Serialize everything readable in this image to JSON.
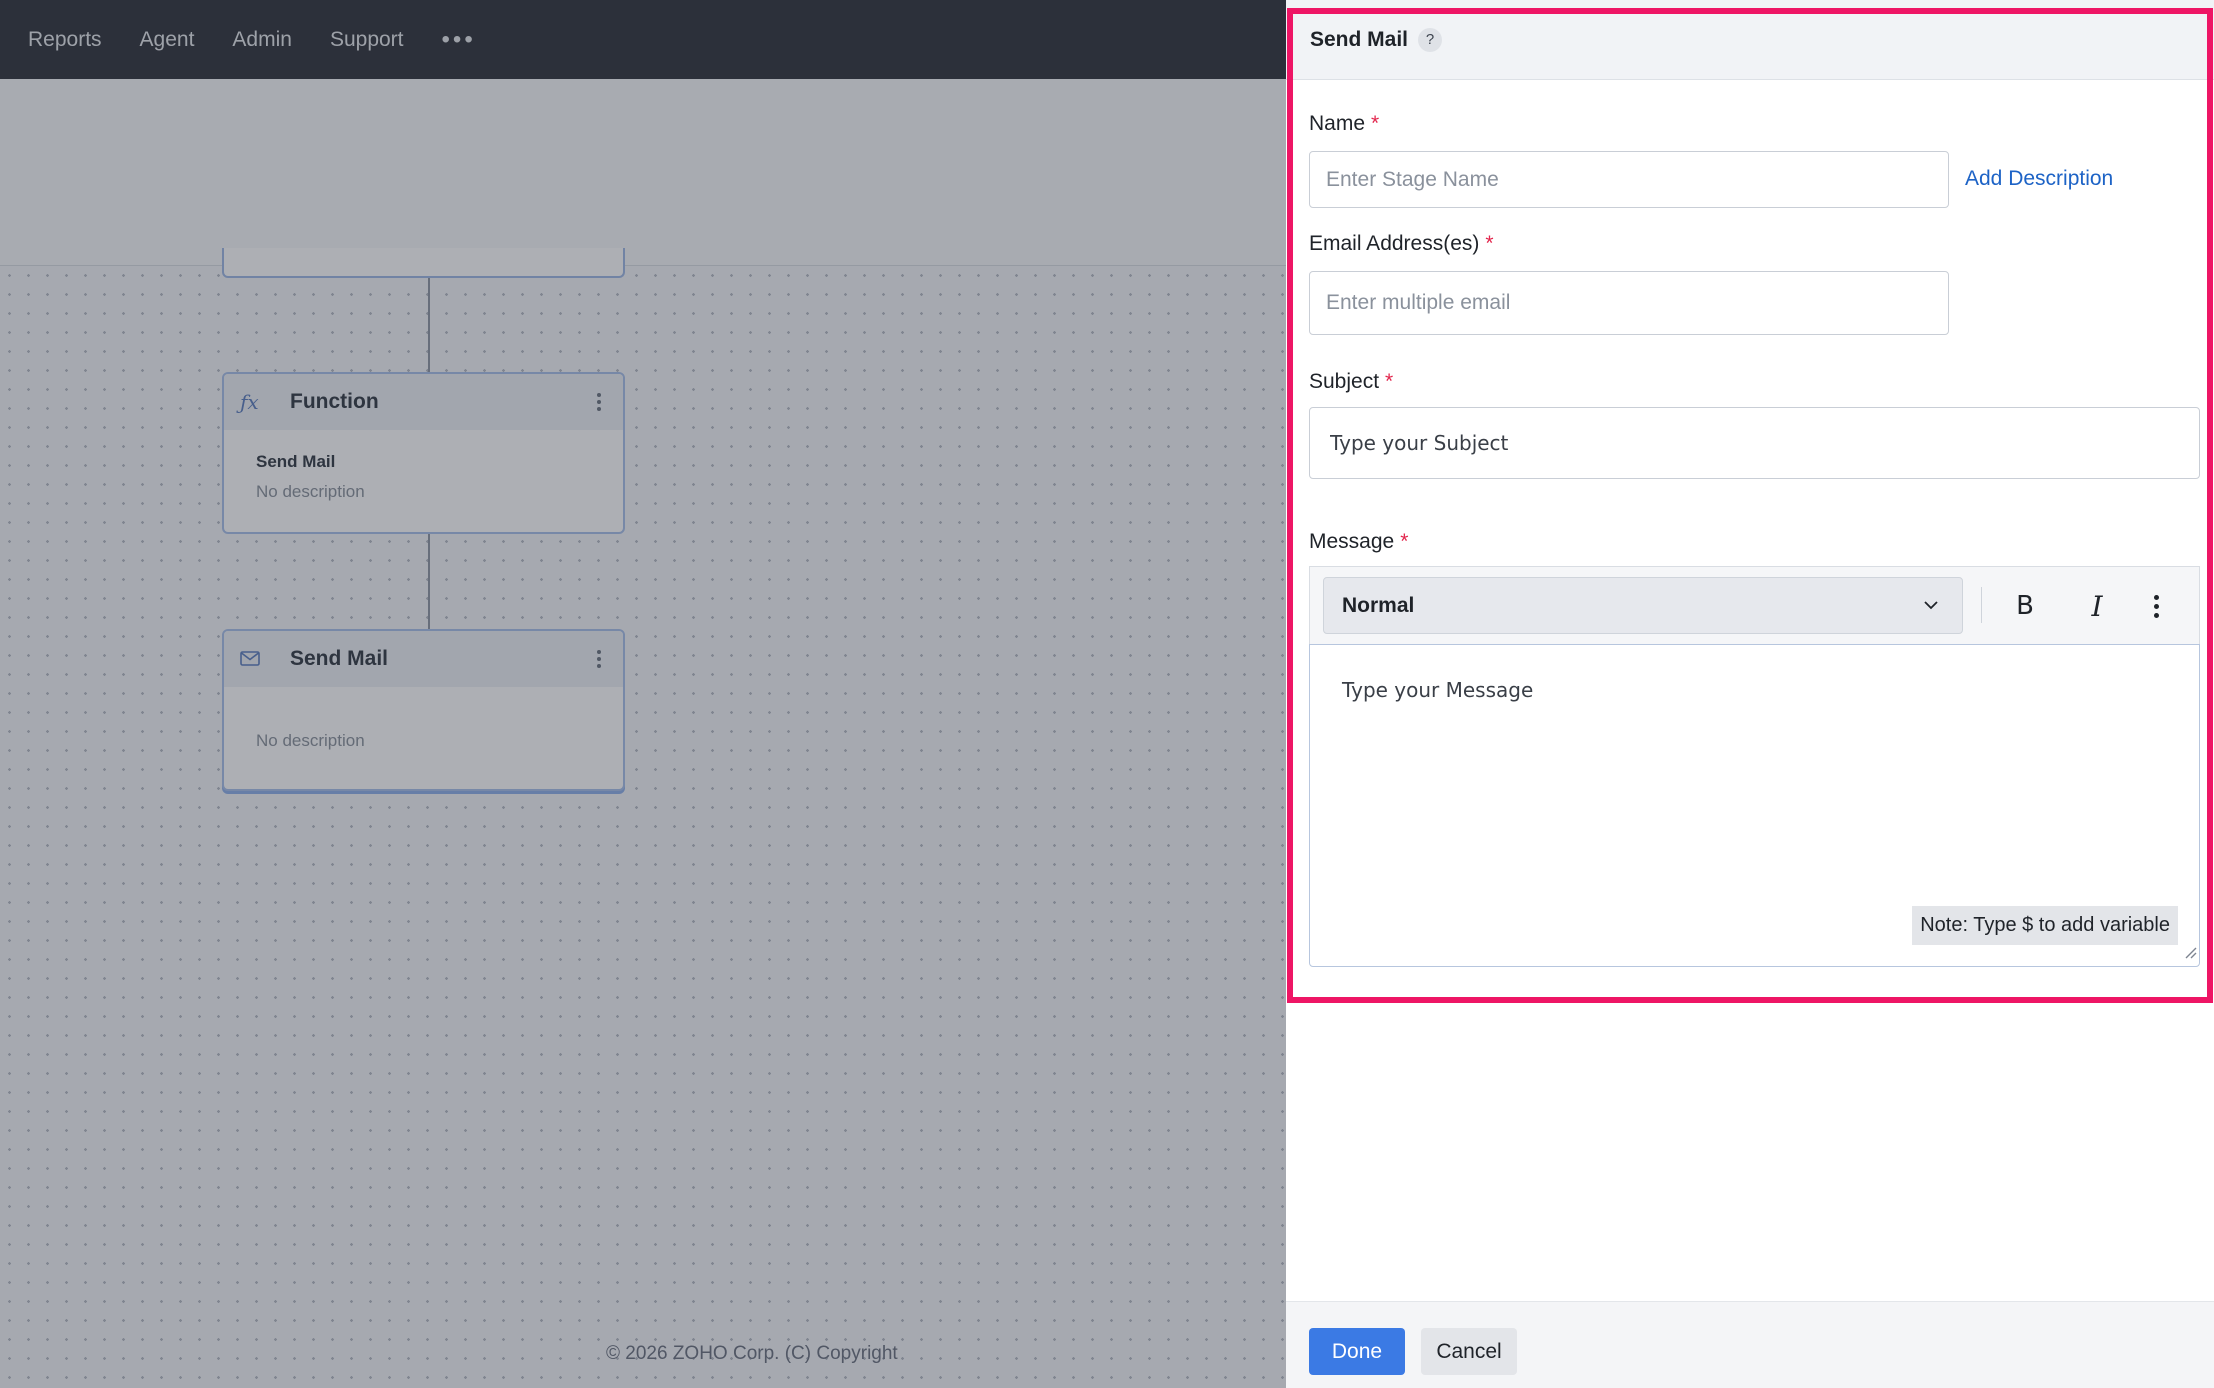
{
  "topnav": {
    "items": [
      "Reports",
      "Agent",
      "Admin",
      "Support"
    ],
    "more_label": "•••"
  },
  "canvas": {
    "function_node": {
      "type": "Function",
      "name": "Send Mail",
      "description": "No description",
      "icon": "function-icon"
    },
    "mail_node": {
      "type": "Send Mail",
      "description": "No description",
      "icon": "envelope-icon"
    }
  },
  "footer": {
    "copyright": "© 2026 ZOHO Corp. (C) Copyright"
  },
  "drawer": {
    "title": "Send Mail",
    "help_label": "?",
    "name": {
      "label": "Name",
      "required_mark": "*",
      "placeholder": "Enter Stage Name",
      "value": ""
    },
    "add_description_label": "Add Description",
    "email": {
      "label": "Email Address(es)",
      "required_mark": "*",
      "placeholder": "Enter multiple email",
      "value": ""
    },
    "subject": {
      "label": "Subject",
      "required_mark": "*",
      "placeholder": "Type your Subject",
      "value": ""
    },
    "message": {
      "label": "Message",
      "required_mark": "*",
      "format_value": "Normal",
      "bold_label": "B",
      "italic_label": "I",
      "placeholder": "Type your Message",
      "note": "Note: Type $ to add variable"
    },
    "done_label": "Done",
    "cancel_label": "Cancel"
  },
  "colors": {
    "highlight": "#ee1565",
    "primary": "#3b7ae4",
    "link": "#1d63c6",
    "required": "#e2264d"
  }
}
